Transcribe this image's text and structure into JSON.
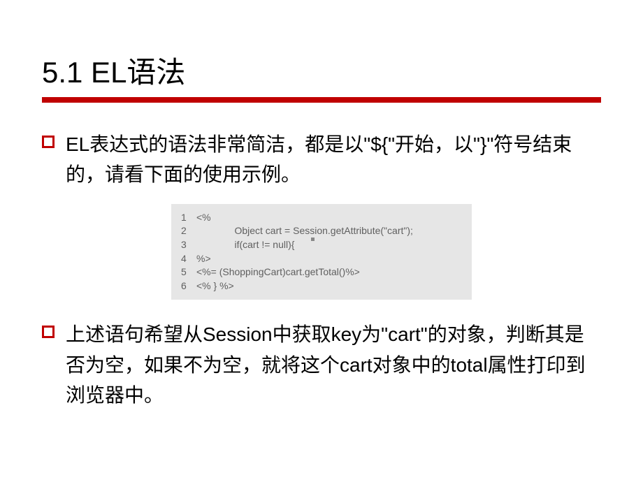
{
  "title": "5.1  EL语法",
  "paragraph1": "EL表达式的语法非常简洁，都是以\"${\"开始，以\"}\"符号结束的，请看下面的使用示例。",
  "paragraph2": "上述语句希望从Session中获取key为\"cart\"的对象，判断其是否为空，如果不为空，就将这个cart对象中的total属性打印到浏览器中。",
  "code": {
    "lines": [
      {
        "num": "1",
        "text": "<%"
      },
      {
        "num": "2",
        "text": "              Object cart = Session.getAttribute(\"cart\");"
      },
      {
        "num": "3",
        "text": "              if(cart != null){"
      },
      {
        "num": "4",
        "text": "%>"
      },
      {
        "num": "5",
        "text": "<%= (ShoppingCart)cart.getTotal()%>"
      },
      {
        "num": "6",
        "text": "<% } %>"
      }
    ]
  }
}
